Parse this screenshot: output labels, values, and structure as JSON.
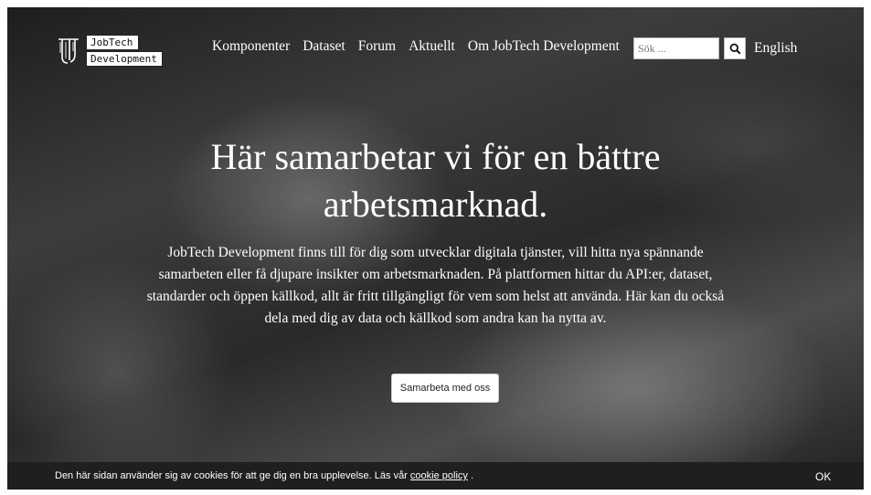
{
  "logo": {
    "line1": "JobTech",
    "line2": "Development"
  },
  "nav": {
    "items": [
      {
        "label": "Komponenter"
      },
      {
        "label": "Dataset"
      },
      {
        "label": "Forum"
      },
      {
        "label": "Aktuellt"
      },
      {
        "label": "Om JobTech Development"
      }
    ]
  },
  "search": {
    "placeholder": "Sök ...",
    "icon": "search-icon"
  },
  "language": {
    "label": "English"
  },
  "hero": {
    "title": "Här samarbetar vi för en bättre arbetsmarknad.",
    "text": "JobTech Development finns till för dig som utvecklar digitala tjänster, vill hitta nya spännande samarbeten eller få djupare insikter om arbetsmarknaden. På plattformen hittar du API:er, dataset, standarder och öppen källkod, allt är fritt tillgängligt för vem som helst att använda. Här kan du också dela med dig av data och källkod som andra kan ha nytta av.",
    "cta_label": "Samarbeta med oss"
  },
  "cookie": {
    "text": "Den här sidan använder sig av cookies för att ge dig en bra upplevelse. Läs vår ",
    "link_label": "cookie policy",
    "suffix": " .",
    "ok_label": "OK"
  }
}
